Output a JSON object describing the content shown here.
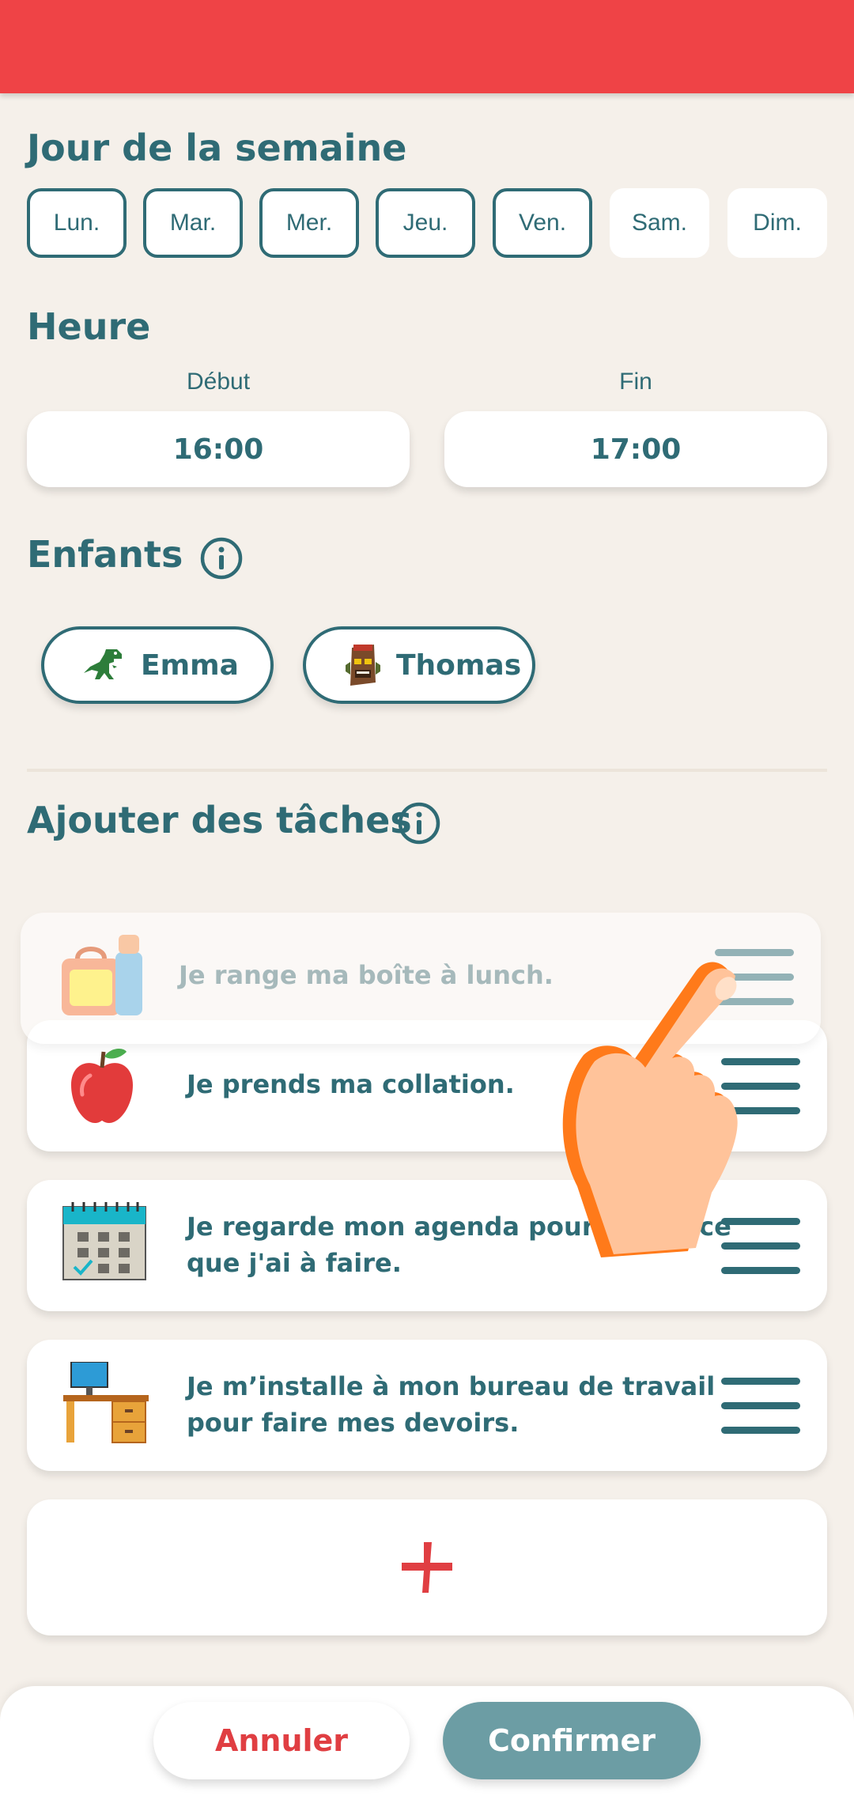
{
  "header": {
    "color": "#ef4346"
  },
  "weekday": {
    "title": "Jour de la semaine",
    "days": [
      {
        "label": "Lun.",
        "selected": true
      },
      {
        "label": "Mar.",
        "selected": true
      },
      {
        "label": "Mer.",
        "selected": true
      },
      {
        "label": "Jeu.",
        "selected": true
      },
      {
        "label": "Ven.",
        "selected": true
      },
      {
        "label": "Sam.",
        "selected": false
      },
      {
        "label": "Dim.",
        "selected": false
      }
    ]
  },
  "time": {
    "title": "Heure",
    "start_label": "Début",
    "start_value": "16:00",
    "end_label": "Fin",
    "end_value": "17:00"
  },
  "children": {
    "title": "Enfants",
    "info_icon": "info-icon",
    "items": [
      {
        "name": "Emma",
        "avatar": "dinosaur-icon"
      },
      {
        "name": "Thomas",
        "avatar": "tiki-mask-icon"
      }
    ]
  },
  "tasks": {
    "title": "Ajouter des tâches",
    "info_icon": "info-icon",
    "dragging_item": {
      "text": "Je range ma boîte à lunch.",
      "icon": "lunchbox-icon"
    },
    "items": [
      {
        "text": "Je prends ma collation.",
        "icon": "apple-icon"
      },
      {
        "text": "Je regarde mon agenda pour savoir ce que j'ai à faire.",
        "icon": "calendar-icon"
      },
      {
        "text": "Je m’installe à mon bureau de travail pour faire mes devoirs.",
        "icon": "desk-icon"
      }
    ],
    "add_icon": "plus-icon"
  },
  "footer": {
    "cancel_label": "Annuler",
    "confirm_label": "Confirmer"
  },
  "colors": {
    "primary": "#2f6b75",
    "accent_red": "#ef4346",
    "background": "#f5f0ea",
    "confirm_button": "#6c9da4"
  }
}
